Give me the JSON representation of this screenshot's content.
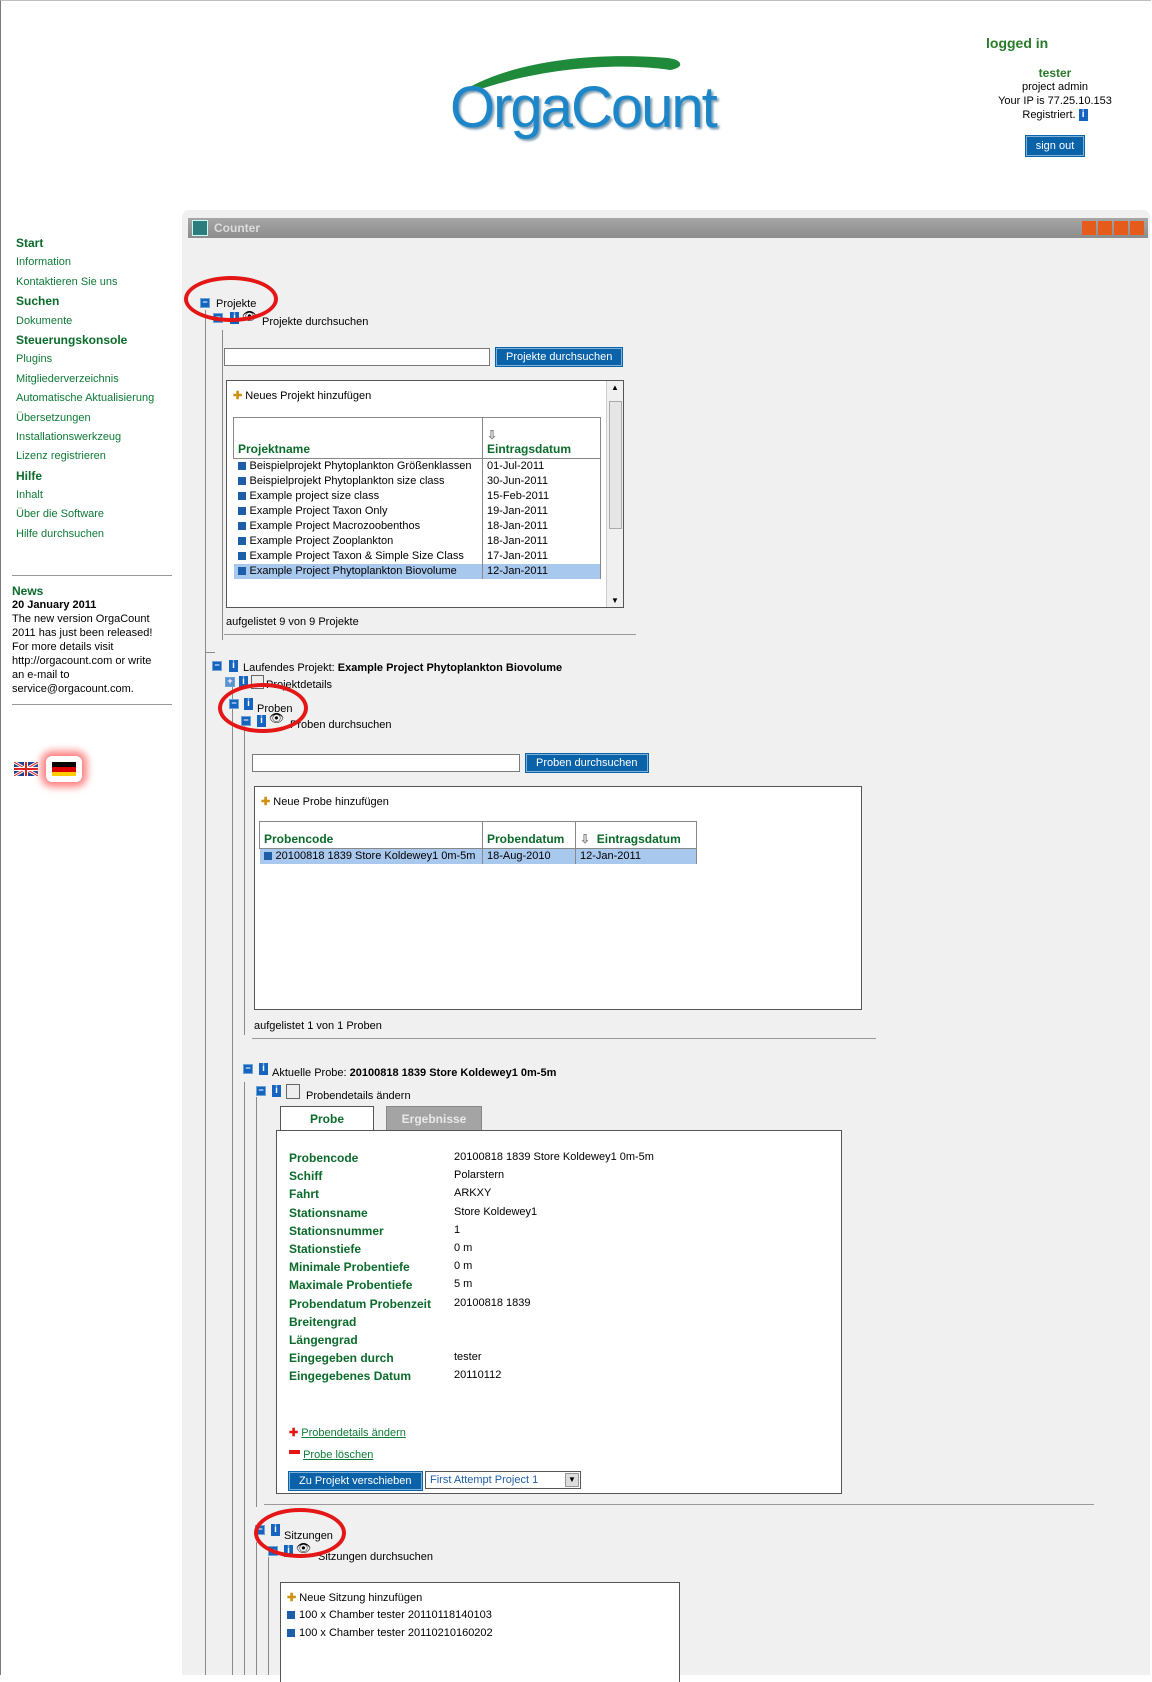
{
  "app": {
    "logo_text": "OrgaCount",
    "window_title": "Counter"
  },
  "login": {
    "status": "logged in",
    "user": "tester",
    "role": "project admin",
    "ip": "Your IP is 77.25.10.153",
    "registered": "Registriert.",
    "signout": "sign out"
  },
  "nav": {
    "items": [
      {
        "label": "Start",
        "heading": true
      },
      {
        "label": "Information"
      },
      {
        "label": "Kontaktieren Sie uns"
      },
      {
        "label": "Suchen",
        "heading": true
      },
      {
        "label": "Dokumente"
      },
      {
        "label": "Steuerungskonsole",
        "heading": true
      },
      {
        "label": "Plugins"
      },
      {
        "label": "Mitgliederverzeichnis"
      },
      {
        "label": "Automatische Aktualisierung"
      },
      {
        "label": "Übersetzungen"
      },
      {
        "label": "Installationswerkzeug"
      },
      {
        "label": "Lizenz registrieren"
      },
      {
        "label": "Hilfe",
        "heading": true
      },
      {
        "label": "Inhalt"
      },
      {
        "label": "Über die Software"
      },
      {
        "label": "Hilfe durchsuchen"
      }
    ]
  },
  "news": {
    "heading": "News",
    "date": "20 January 2011",
    "lines": [
      "The new version OrgaCount",
      "2011 has just been released!",
      "For more details visit",
      "http://orgacount.com or write",
      "an e-mail to",
      "service@orgacount.com."
    ]
  },
  "projects": {
    "node_label": "Projekte",
    "search_label": "Projekte durchsuchen",
    "search_button": "Projekte durchsuchen",
    "search_value": "",
    "add_label": "Neues Projekt hinzufügen",
    "col_name": "Projektname",
    "col_date": "Eintragsdatum",
    "rows": [
      {
        "name": "Beispielprojekt Phytoplankton Größenklassen",
        "date": "01-Jul-2011"
      },
      {
        "name": "Beispielprojekt Phytoplankton size class",
        "date": "30-Jun-2011"
      },
      {
        "name": "Example project size class",
        "date": "15-Feb-2011"
      },
      {
        "name": "Example Project Taxon Only",
        "date": "19-Jan-2011"
      },
      {
        "name": "Example Project Macrozoobenthos",
        "date": "18-Jan-2011"
      },
      {
        "name": "Example Project Zooplankton",
        "date": "18-Jan-2011"
      },
      {
        "name": "Example Project Taxon & Simple Size Class",
        "date": "17-Jan-2011"
      },
      {
        "name": "Example Project Phytoplankton Biovolume",
        "date": "12-Jan-2011"
      }
    ],
    "count": "aufgelistet 9 von 9 Projekte"
  },
  "current_project": {
    "prefix": "Laufendes Projekt:",
    "name": "Example Project Phytoplankton Biovolume",
    "details_label": "Projektdetails"
  },
  "samples": {
    "node_label": "Proben",
    "search_label": "Proben durchsuchen",
    "search_button": "Proben durchsuchen",
    "add_label": "Neue Probe hinzufügen",
    "col_code": "Probencode",
    "col_sdate": "Probendatum",
    "col_edate": "Eintragsdatum",
    "row": {
      "code": "20100818 1839 Store Koldewey1 0m-5m",
      "sdate": "18-Aug-2010",
      "edate": "12-Jan-2011"
    },
    "count": "aufgelistet 1 von 1 Proben"
  },
  "current_sample": {
    "prefix": "Aktuelle Probe:",
    "name": "20100818 1839 Store Koldewey1 0m-5m",
    "edit_label": "Probendetails ändern",
    "tab_probe": "Probe",
    "tab_results": "Ergebnisse",
    "fields": [
      {
        "k": "Probencode",
        "v": "20100818 1839 Store Koldewey1 0m-5m"
      },
      {
        "k": "Schiff",
        "v": "Polarstern"
      },
      {
        "k": "Fahrt",
        "v": "ARKXY"
      },
      {
        "k": "Stationsname",
        "v": "Store Koldewey1"
      },
      {
        "k": "Stationsnummer",
        "v": "1"
      },
      {
        "k": "Stationstiefe",
        "v": "0 m"
      },
      {
        "k": "Minimale Probentiefe",
        "v": "0 m"
      },
      {
        "k": "Maximale Probentiefe",
        "v": "5 m"
      },
      {
        "k": "Probendatum Probenzeit",
        "v": "20100818 1839"
      },
      {
        "k": "Breitengrad",
        "v": ""
      },
      {
        "k": "Längengrad",
        "v": ""
      },
      {
        "k": "Eingegeben durch",
        "v": "tester"
      },
      {
        "k": "Eingegebenes Datum",
        "v": "20110112"
      }
    ],
    "link_edit": "Probendetails ändern",
    "link_delete": "Probe löschen",
    "move_button": "Zu Projekt verschieben",
    "move_select": "First Attempt Project 1"
  },
  "sessions": {
    "node_label": "Sitzungen",
    "search_label": "Sitzungen durchsuchen",
    "add_label": "Neue Sitzung hinzufügen",
    "items": [
      "100 x Chamber tester 20110118140103",
      "100 x Chamber tester 20110210160202"
    ]
  },
  "colors": {
    "accent": "#0a62a9",
    "green": "#0a6b2a",
    "annotation": "#e41616"
  }
}
